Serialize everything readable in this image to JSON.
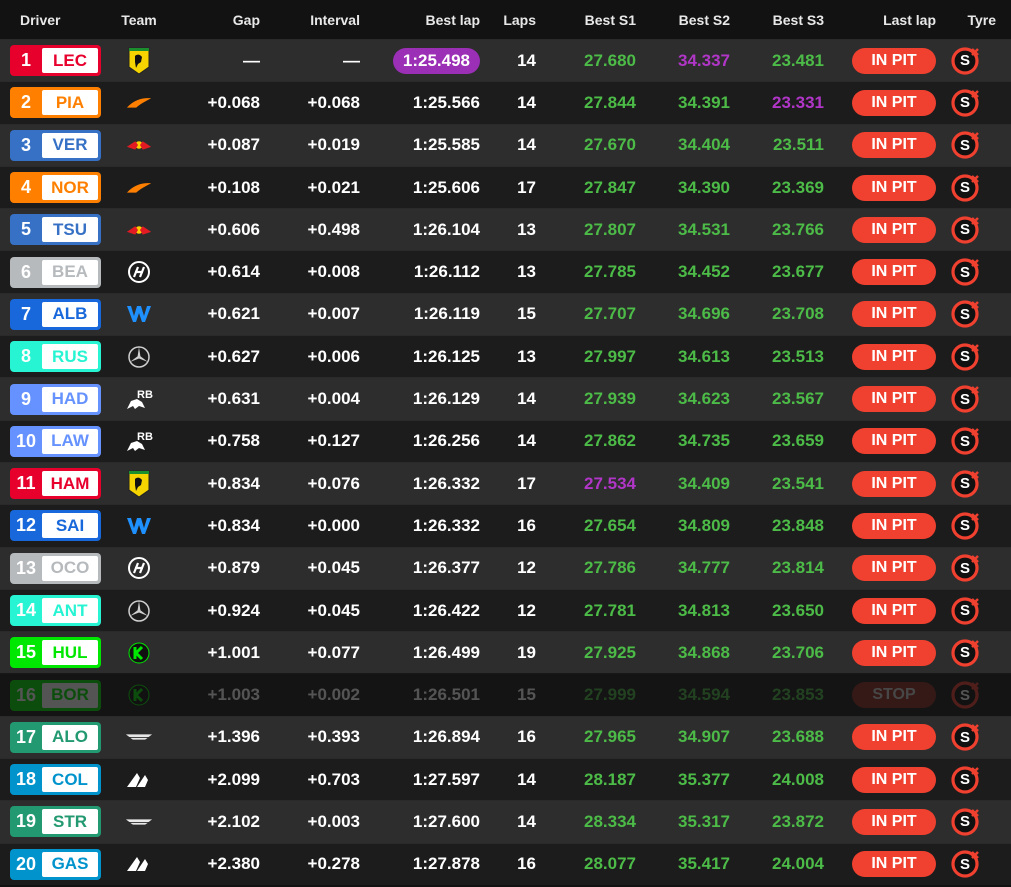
{
  "header": {
    "driver": "Driver",
    "team": "Team",
    "gap": "Gap",
    "interval": "Interval",
    "best_lap": "Best lap",
    "laps": "Laps",
    "s1": "Best S1",
    "s2": "Best S2",
    "s3": "Best S3",
    "last_lap": "Last lap",
    "tyre": "Tyre"
  },
  "colors": {
    "ferrari": "#e8002d",
    "mclaren": "#ff8000",
    "redbull": "#3671c6",
    "haas": "#b6babd",
    "williams": "#1868db",
    "mercedes": "#27f4d2",
    "rb": "#6692ff",
    "sauber": "#00e701",
    "aston": "#229971",
    "alpine": "#0093cc",
    "fastest": "#b136c8",
    "personal_best": "#4cbb47",
    "pit": "#f0402f"
  },
  "tyre_label": "S",
  "rows": [
    {
      "pos": "1",
      "code": "LEC",
      "team": "ferrari",
      "logo": "ferrari-logo-icon",
      "gap": "—",
      "interval": "—",
      "best": "1:25.498",
      "best_fastest": true,
      "laps": "14",
      "s1": "27.680",
      "s2": "34.337",
      "s3": "23.481",
      "s1p": false,
      "s2p": true,
      "s3p": false,
      "last": "IN PIT",
      "stopped": false
    },
    {
      "pos": "2",
      "code": "PIA",
      "team": "mclaren",
      "logo": "mclaren-logo-icon",
      "gap": "+0.068",
      "interval": "+0.068",
      "best": "1:25.566",
      "best_fastest": false,
      "laps": "14",
      "s1": "27.844",
      "s2": "34.391",
      "s3": "23.331",
      "s1p": false,
      "s2p": false,
      "s3p": true,
      "last": "IN PIT",
      "stopped": false
    },
    {
      "pos": "3",
      "code": "VER",
      "team": "redbull",
      "logo": "redbull-logo-icon",
      "gap": "+0.087",
      "interval": "+0.019",
      "best": "1:25.585",
      "best_fastest": false,
      "laps": "14",
      "s1": "27.670",
      "s2": "34.404",
      "s3": "23.511",
      "s1p": false,
      "s2p": false,
      "s3p": false,
      "last": "IN PIT",
      "stopped": false
    },
    {
      "pos": "4",
      "code": "NOR",
      "team": "mclaren",
      "logo": "mclaren-logo-icon",
      "gap": "+0.108",
      "interval": "+0.021",
      "best": "1:25.606",
      "best_fastest": false,
      "laps": "17",
      "s1": "27.847",
      "s2": "34.390",
      "s3": "23.369",
      "s1p": false,
      "s2p": false,
      "s3p": false,
      "last": "IN PIT",
      "stopped": false
    },
    {
      "pos": "5",
      "code": "TSU",
      "team": "redbull",
      "logo": "redbull-logo-icon",
      "gap": "+0.606",
      "interval": "+0.498",
      "best": "1:26.104",
      "best_fastest": false,
      "laps": "13",
      "s1": "27.807",
      "s2": "34.531",
      "s3": "23.766",
      "s1p": false,
      "s2p": false,
      "s3p": false,
      "last": "IN PIT",
      "stopped": false
    },
    {
      "pos": "6",
      "code": "BEA",
      "team": "haas",
      "logo": "haas-logo-icon",
      "gap": "+0.614",
      "interval": "+0.008",
      "best": "1:26.112",
      "best_fastest": false,
      "laps": "13",
      "s1": "27.785",
      "s2": "34.452",
      "s3": "23.677",
      "s1p": false,
      "s2p": false,
      "s3p": false,
      "last": "IN PIT",
      "stopped": false
    },
    {
      "pos": "7",
      "code": "ALB",
      "team": "williams",
      "logo": "williams-logo-icon",
      "gap": "+0.621",
      "interval": "+0.007",
      "best": "1:26.119",
      "best_fastest": false,
      "laps": "15",
      "s1": "27.707",
      "s2": "34.696",
      "s3": "23.708",
      "s1p": false,
      "s2p": false,
      "s3p": false,
      "last": "IN PIT",
      "stopped": false
    },
    {
      "pos": "8",
      "code": "RUS",
      "team": "mercedes",
      "logo": "mercedes-logo-icon",
      "gap": "+0.627",
      "interval": "+0.006",
      "best": "1:26.125",
      "best_fastest": false,
      "laps": "13",
      "s1": "27.997",
      "s2": "34.613",
      "s3": "23.513",
      "s1p": false,
      "s2p": false,
      "s3p": false,
      "last": "IN PIT",
      "stopped": false
    },
    {
      "pos": "9",
      "code": "HAD",
      "team": "rb",
      "logo": "rb-logo-icon",
      "gap": "+0.631",
      "interval": "+0.004",
      "best": "1:26.129",
      "best_fastest": false,
      "laps": "14",
      "s1": "27.939",
      "s2": "34.623",
      "s3": "23.567",
      "s1p": false,
      "s2p": false,
      "s3p": false,
      "last": "IN PIT",
      "stopped": false
    },
    {
      "pos": "10",
      "code": "LAW",
      "team": "rb",
      "logo": "rb-logo-icon",
      "gap": "+0.758",
      "interval": "+0.127",
      "best": "1:26.256",
      "best_fastest": false,
      "laps": "14",
      "s1": "27.862",
      "s2": "34.735",
      "s3": "23.659",
      "s1p": false,
      "s2p": false,
      "s3p": false,
      "last": "IN PIT",
      "stopped": false
    },
    {
      "pos": "11",
      "code": "HAM",
      "team": "ferrari",
      "logo": "ferrari-logo-icon",
      "gap": "+0.834",
      "interval": "+0.076",
      "best": "1:26.332",
      "best_fastest": false,
      "laps": "17",
      "s1": "27.534",
      "s2": "34.409",
      "s3": "23.541",
      "s1p": true,
      "s2p": false,
      "s3p": false,
      "last": "IN PIT",
      "stopped": false
    },
    {
      "pos": "12",
      "code": "SAI",
      "team": "williams",
      "logo": "williams-logo-icon",
      "gap": "+0.834",
      "interval": "+0.000",
      "best": "1:26.332",
      "best_fastest": false,
      "laps": "16",
      "s1": "27.654",
      "s2": "34.809",
      "s3": "23.848",
      "s1p": false,
      "s2p": false,
      "s3p": false,
      "last": "IN PIT",
      "stopped": false
    },
    {
      "pos": "13",
      "code": "OCO",
      "team": "haas",
      "logo": "haas-logo-icon",
      "gap": "+0.879",
      "interval": "+0.045",
      "best": "1:26.377",
      "best_fastest": false,
      "laps": "12",
      "s1": "27.786",
      "s2": "34.777",
      "s3": "23.814",
      "s1p": false,
      "s2p": false,
      "s3p": false,
      "last": "IN PIT",
      "stopped": false
    },
    {
      "pos": "14",
      "code": "ANT",
      "team": "mercedes",
      "logo": "mercedes-logo-icon",
      "gap": "+0.924",
      "interval": "+0.045",
      "best": "1:26.422",
      "best_fastest": false,
      "laps": "12",
      "s1": "27.781",
      "s2": "34.813",
      "s3": "23.650",
      "s1p": false,
      "s2p": false,
      "s3p": false,
      "last": "IN PIT",
      "stopped": false
    },
    {
      "pos": "15",
      "code": "HUL",
      "team": "sauber",
      "logo": "sauber-logo-icon",
      "gap": "+1.001",
      "interval": "+0.077",
      "best": "1:26.499",
      "best_fastest": false,
      "laps": "19",
      "s1": "27.925",
      "s2": "34.868",
      "s3": "23.706",
      "s1p": false,
      "s2p": false,
      "s3p": false,
      "last": "IN PIT",
      "stopped": false
    },
    {
      "pos": "16",
      "code": "BOR",
      "team": "sauber",
      "logo": "sauber-logo-icon",
      "gap": "+1.003",
      "interval": "+0.002",
      "best": "1:26.501",
      "best_fastest": false,
      "laps": "15",
      "s1": "27.999",
      "s2": "34.594",
      "s3": "23.853",
      "s1p": false,
      "s2p": false,
      "s3p": false,
      "last": "STOP",
      "stopped": true
    },
    {
      "pos": "17",
      "code": "ALO",
      "team": "aston",
      "logo": "aston-logo-icon",
      "gap": "+1.396",
      "interval": "+0.393",
      "best": "1:26.894",
      "best_fastest": false,
      "laps": "16",
      "s1": "27.965",
      "s2": "34.907",
      "s3": "23.688",
      "s1p": false,
      "s2p": false,
      "s3p": false,
      "last": "IN PIT",
      "stopped": false
    },
    {
      "pos": "18",
      "code": "COL",
      "team": "alpine",
      "logo": "alpine-logo-icon",
      "gap": "+2.099",
      "interval": "+0.703",
      "best": "1:27.597",
      "best_fastest": false,
      "laps": "14",
      "s1": "28.187",
      "s2": "35.377",
      "s3": "24.008",
      "s1p": false,
      "s2p": false,
      "s3p": false,
      "last": "IN PIT",
      "stopped": false
    },
    {
      "pos": "19",
      "code": "STR",
      "team": "aston",
      "logo": "aston-logo-icon",
      "gap": "+2.102",
      "interval": "+0.003",
      "best": "1:27.600",
      "best_fastest": false,
      "laps": "14",
      "s1": "28.334",
      "s2": "35.317",
      "s3": "23.872",
      "s1p": false,
      "s2p": false,
      "s3p": false,
      "last": "IN PIT",
      "stopped": false
    },
    {
      "pos": "20",
      "code": "GAS",
      "team": "alpine",
      "logo": "alpine-logo-icon",
      "gap": "+2.380",
      "interval": "+0.278",
      "best": "1:27.878",
      "best_fastest": false,
      "laps": "16",
      "s1": "28.077",
      "s2": "35.417",
      "s3": "24.004",
      "s1p": false,
      "s2p": false,
      "s3p": false,
      "last": "IN PIT",
      "stopped": false
    }
  ]
}
